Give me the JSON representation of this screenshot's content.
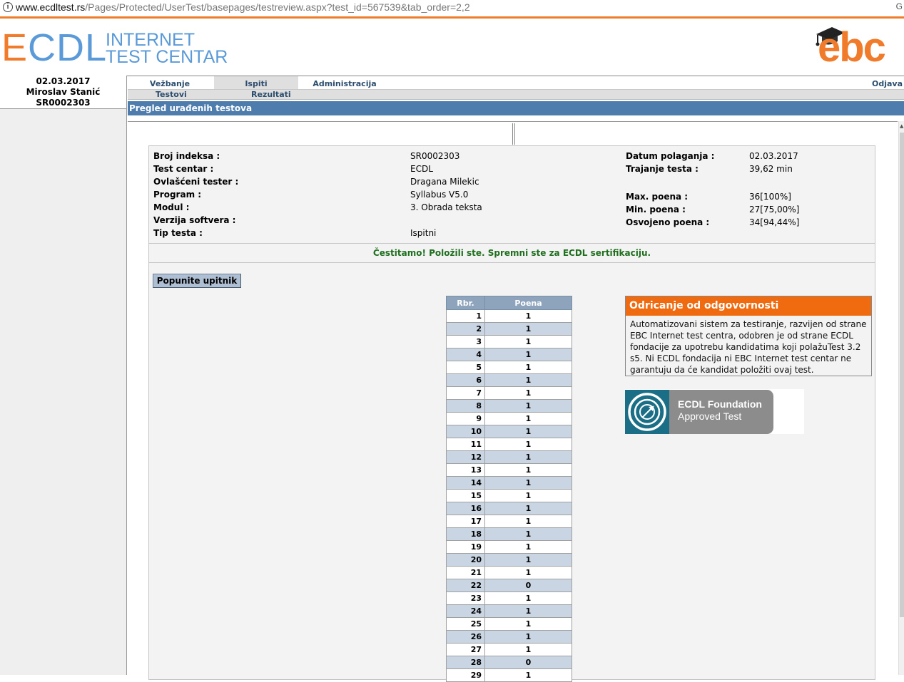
{
  "browser": {
    "url_host": "www.ecdltest.rs",
    "url_path": "/Pages/Protected/UserTest/basepages/testreview.aspx?test_id=567539&tab_order=2,2"
  },
  "logo": {
    "ecdl_letters": "ECDL",
    "ecdl_line1": "INTERNET",
    "ecdl_line2": "TEST CENTAR",
    "ebc": "ebc"
  },
  "sidebar": {
    "date": "02.03.2017",
    "name": "Miroslav Stanić",
    "id": "SR0002303"
  },
  "nav": {
    "tabs": [
      "Vežbanje",
      "Ispiti",
      "Administracija"
    ],
    "active_tab": "Ispiti",
    "logout": "Odjava",
    "subtabs": [
      "Testovi",
      "Rezultati"
    ]
  },
  "page_title": "Pregled urađenih testova",
  "details": {
    "left_labels": [
      "Broj indeksa :",
      "Test centar :",
      "Ovlašćeni tester :",
      "Program :",
      "Modul :",
      "Verzija softvera :",
      "Tip testa :"
    ],
    "left_values": [
      "SR0002303",
      "ECDL",
      "Dragana Milekic",
      "Syllabus V5.0",
      "3. Obrada teksta",
      "",
      "Ispitni"
    ],
    "date_label": "Datum polaganja :",
    "date_value": "02.03.2017",
    "duration_label": "Trajanje testa :",
    "duration_value": "39,62 min",
    "max_label": "Max. poena :",
    "max_value": "36[100%]",
    "min_label": "Min. poena :",
    "min_value": "27[75,00%]",
    "won_label": "Osvojeno poena :",
    "won_value": "34[94,44%]"
  },
  "congrats": "Čestitamo! Položili ste. Spremni ste za ECDL sertifikaciju.",
  "survey_button": "Popunite upitnik",
  "score_table": {
    "headers": [
      "Rbr.",
      "Poena"
    ],
    "rows": [
      [
        "1",
        "1"
      ],
      [
        "2",
        "1"
      ],
      [
        "3",
        "1"
      ],
      [
        "4",
        "1"
      ],
      [
        "5",
        "1"
      ],
      [
        "6",
        "1"
      ],
      [
        "7",
        "1"
      ],
      [
        "8",
        "1"
      ],
      [
        "9",
        "1"
      ],
      [
        "10",
        "1"
      ],
      [
        "11",
        "1"
      ],
      [
        "12",
        "1"
      ],
      [
        "13",
        "1"
      ],
      [
        "14",
        "1"
      ],
      [
        "15",
        "1"
      ],
      [
        "16",
        "1"
      ],
      [
        "17",
        "1"
      ],
      [
        "18",
        "1"
      ],
      [
        "19",
        "1"
      ],
      [
        "20",
        "1"
      ],
      [
        "21",
        "1"
      ],
      [
        "22",
        "0"
      ],
      [
        "23",
        "1"
      ],
      [
        "24",
        "1"
      ],
      [
        "25",
        "1"
      ],
      [
        "26",
        "1"
      ],
      [
        "27",
        "1"
      ],
      [
        "28",
        "0"
      ],
      [
        "29",
        "1"
      ]
    ]
  },
  "disclaimer": {
    "title": "Odricanje od odgovornosti",
    "body": "Automatizovani sistem za testiranje, razvijen od strane EBC Internet test centra, odobren je od strane ECDL fondacije za upotrebu kandidatima koji polažuTest 3.2 s5. Ni ECDL fondacija ni EBC Internet test centar ne garantuju da će kandidat položiti ovaj test."
  },
  "ecdl_foundation": {
    "line1": "ECDL Foundation",
    "line2": "Approved Test"
  }
}
